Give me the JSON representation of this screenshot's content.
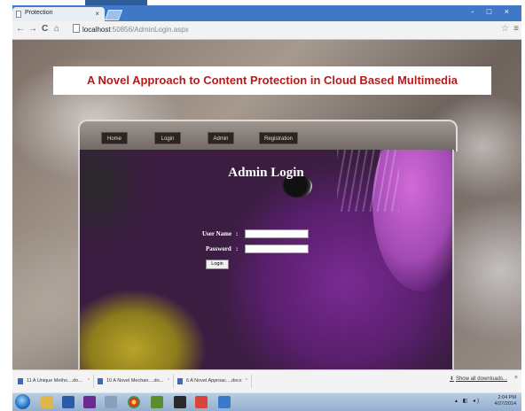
{
  "browser": {
    "tab_title": "Protection",
    "tab_close": "×",
    "back": "←",
    "forward": "→",
    "reload": "C",
    "home": "⌂",
    "url_host": "localhost",
    "url_rest": ":50856/AdminLogin.aspx",
    "window_controls": "- □ ×",
    "bookmark_star": "☆",
    "menu": "≡"
  },
  "page": {
    "banner_title": "A Novel Approach to Content Protection in Cloud Based Multimedia",
    "nav": {
      "home": "Home",
      "login": "Login",
      "admin": "Admin",
      "registration": "Registration"
    },
    "heading": "Admin Login",
    "form": {
      "username_label": "User Name",
      "password_label": "Password",
      "colon": ":",
      "username_value": "",
      "password_value": "",
      "login_button": "Login"
    }
  },
  "downloads": {
    "items": [
      {
        "name": "11 A Unique Metho....do..."
      },
      {
        "name": "10 A Novel Mechan....do..."
      },
      {
        "name": "6 A Novel Approac....docx"
      }
    ],
    "caret": "^",
    "show_all": "Show all downloads...",
    "close": "×"
  },
  "taskbar": {
    "clock_time": "2:04 PM",
    "clock_date": "4/27/2014"
  }
}
